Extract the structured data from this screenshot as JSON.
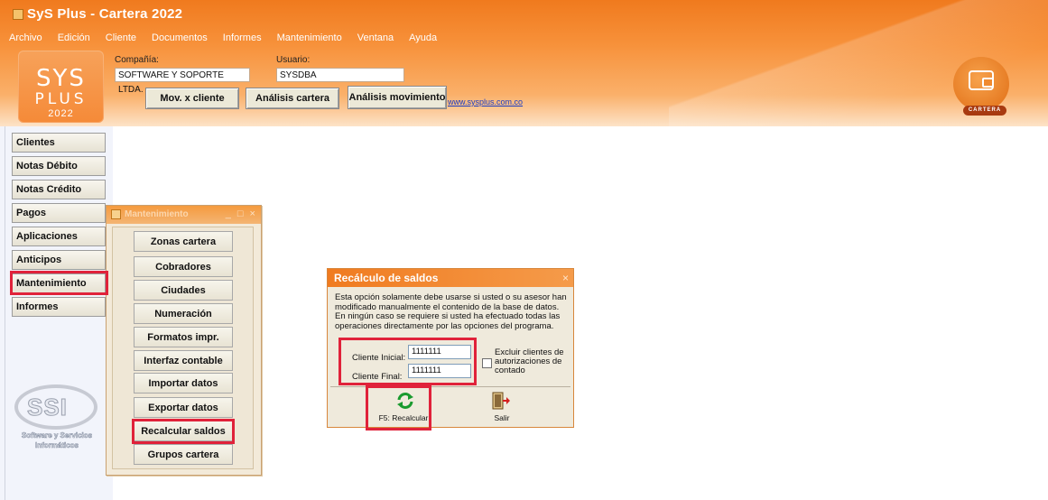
{
  "window": {
    "title": "SyS Plus - Cartera 2022"
  },
  "menu": [
    {
      "label": "Archivo",
      "key": "A"
    },
    {
      "label": "Edición",
      "key": "E"
    },
    {
      "label": "Cliente",
      "key": "C"
    },
    {
      "label": "Documentos",
      "key": "D"
    },
    {
      "label": "Informes",
      "key": "I"
    },
    {
      "label": "Mantenimiento",
      "key": "M"
    },
    {
      "label": "Ventana",
      "key": "V"
    },
    {
      "label": "Ayuda",
      "key": "y"
    }
  ],
  "logo": {
    "line1": "SYS",
    "line2": "PLUS",
    "year": "2022"
  },
  "company": {
    "label": "Compañía:",
    "value": "SOFTWARE Y SOPORTE LTDA."
  },
  "user": {
    "label": "Usuario:",
    "value": "SYSDBA"
  },
  "toolbar": {
    "mov_cliente": "Mov. x cliente",
    "analisis_cartera": "Análisis cartera",
    "analisis_movimiento": "Análisis movimiento",
    "website": "www.sysplus.com.co"
  },
  "module_badge": "CARTERA",
  "sidebar": [
    {
      "label": "Clientes",
      "highlighted": false
    },
    {
      "label": "Notas Débito",
      "highlighted": false
    },
    {
      "label": "Notas Crédito",
      "highlighted": false
    },
    {
      "label": "Pagos",
      "highlighted": false
    },
    {
      "label": "Aplicaciones",
      "highlighted": false
    },
    {
      "label": "Anticipos",
      "highlighted": false
    },
    {
      "label": "Mantenimiento",
      "highlighted": true
    },
    {
      "label": "Informes",
      "highlighted": false
    }
  ],
  "brand": {
    "logo_text": "SSI",
    "caption_line1": "Software y Servicios",
    "caption_line2": "Informáticos"
  },
  "maint_window": {
    "title": "Mantenimiento",
    "buttons": [
      {
        "label": "Zonas cartera",
        "highlighted": false
      },
      {
        "label": "Cobradores",
        "highlighted": false
      },
      {
        "label": "Ciudades",
        "highlighted": false
      },
      {
        "label": "Numeración",
        "highlighted": false
      },
      {
        "label": "Formatos impr.",
        "highlighted": false
      },
      {
        "label": "Interfaz contable",
        "highlighted": false
      },
      {
        "label": "Importar datos",
        "highlighted": false
      },
      {
        "label": "Exportar datos",
        "highlighted": false
      },
      {
        "label": "Recalcular saldos",
        "highlighted": true
      },
      {
        "label": "Grupos cartera",
        "highlighted": false
      }
    ]
  },
  "dialog": {
    "title": "Recálculo de saldos",
    "message": "Esta opción solamente debe usarse si usted o su asesor han modificado manualmente el contenido de la base de datos. En ningún caso se requiere si usted ha efectuado todas las operaciones directamente por las opciones del programa.",
    "cliente_inicial_label": "Cliente Inicial:",
    "cliente_inicial_value": "1111111",
    "cliente_final_label": "Cliente Final:",
    "cliente_final_value": "1111111",
    "excluir_label": "Excluir clientes de autorizaciones de contado",
    "excluir_checked": false,
    "recalc_label": "F5: Recalcular",
    "salir_label": "Salir"
  },
  "colors": {
    "accent": "#f07a1e",
    "highlight": "#e0223a"
  }
}
